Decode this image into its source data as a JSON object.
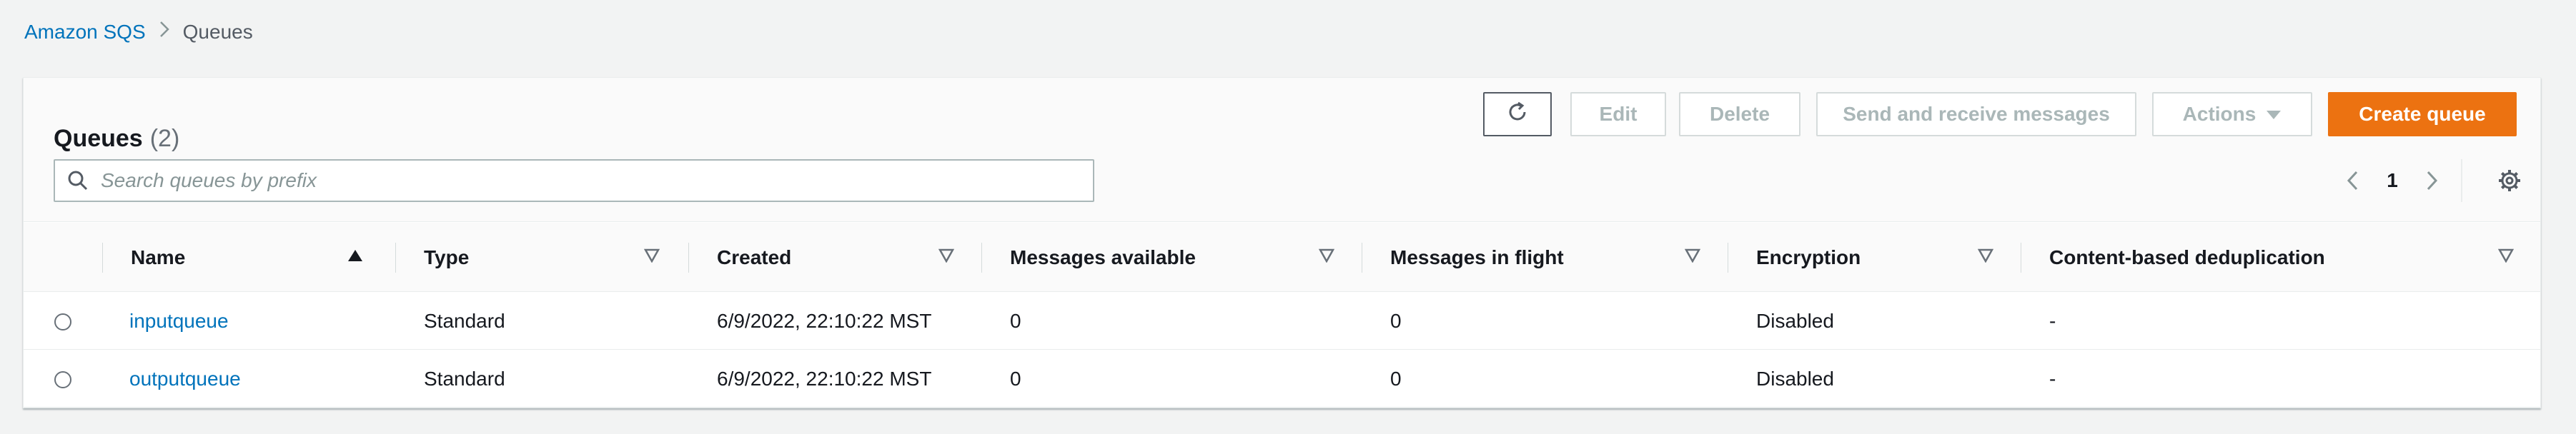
{
  "breadcrumb": {
    "root": "Amazon SQS",
    "separator": ">",
    "current": "Queues"
  },
  "panel": {
    "title": "Queues",
    "count": "(2)"
  },
  "toolbar": {
    "refresh_icon": "refresh-icon",
    "edit_label": "Edit",
    "delete_label": "Delete",
    "send_receive_label": "Send and receive messages",
    "actions_label": "Actions",
    "create_label": "Create queue"
  },
  "search": {
    "placeholder": "Search queues by prefix",
    "value": ""
  },
  "pagination": {
    "current_page": "1"
  },
  "table": {
    "columns": [
      {
        "label": "Name",
        "sort": "ascending"
      },
      {
        "label": "Type",
        "sort": "none"
      },
      {
        "label": "Created",
        "sort": "none"
      },
      {
        "label": "Messages available",
        "sort": "none"
      },
      {
        "label": "Messages in flight",
        "sort": "none"
      },
      {
        "label": "Encryption",
        "sort": "none"
      },
      {
        "label": "Content-based deduplication",
        "sort": "none"
      }
    ],
    "rows": [
      {
        "name": "inputqueue",
        "type": "Standard",
        "created": "6/9/2022, 22:10:22 MST",
        "messages_available": "0",
        "messages_in_flight": "0",
        "encryption": "Disabled",
        "dedup": "-"
      },
      {
        "name": "outputqueue",
        "type": "Standard",
        "created": "6/9/2022, 22:10:22 MST",
        "messages_available": "0",
        "messages_in_flight": "0",
        "encryption": "Disabled",
        "dedup": "-"
      }
    ]
  },
  "colors": {
    "link": "#0073bb",
    "primary": "#ec7211",
    "disabled_text": "#aab7b8",
    "background": "#f2f3f3"
  }
}
